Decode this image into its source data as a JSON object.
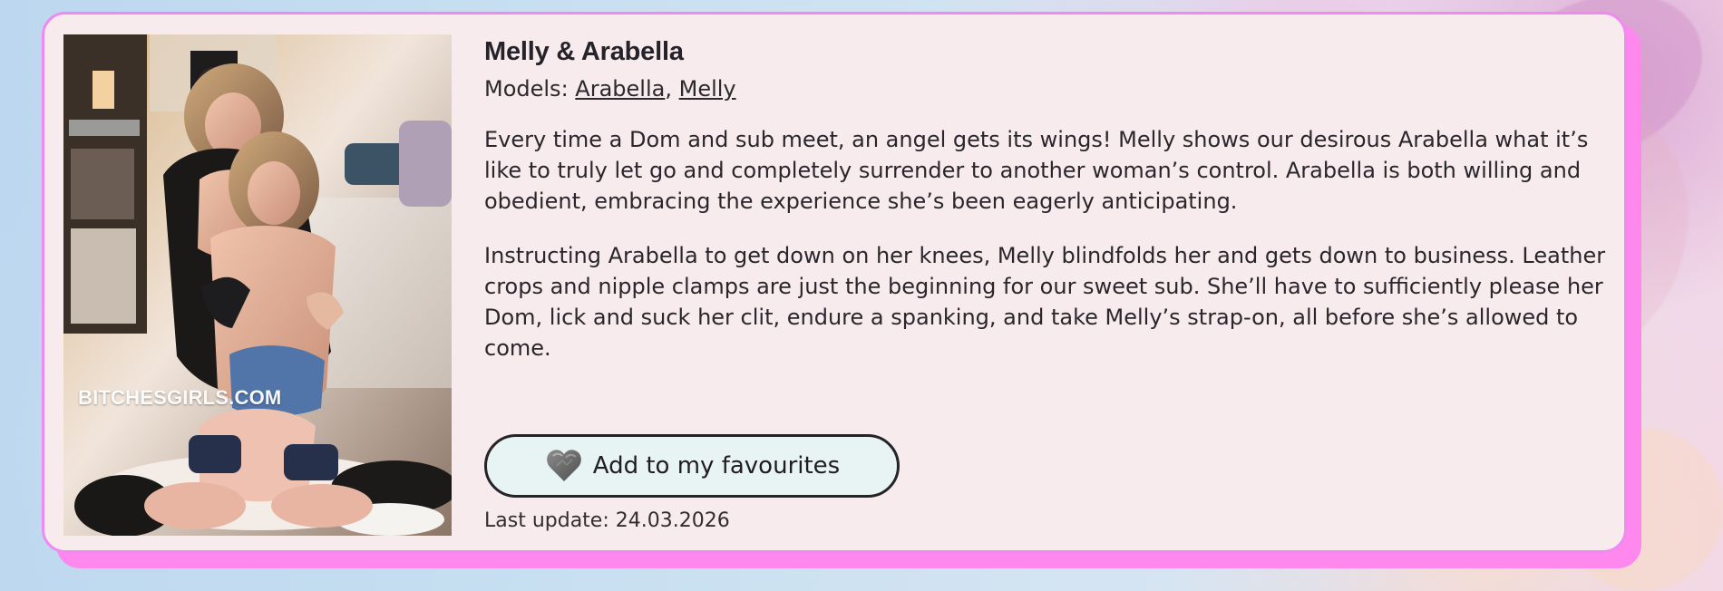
{
  "card": {
    "title": "Melly & Arabella",
    "models_label": "Models:",
    "models": [
      {
        "name": "Arabella"
      },
      {
        "name": "Melly"
      }
    ],
    "description": [
      "Every time a Dom and sub meet, an angel gets its wings! Melly shows our desirous Arabella what it’s like to truly let go and completely surrender to another woman’s control. Arabella is both willing and obedient, embracing the experience she’s been eagerly anticipating.",
      "Instructing Arabella to get down on her knees, Melly blindfolds her and gets down to business. Leather crops and nipple clamps are just the beginning for our sweet sub. She’ll have to sufficiently please her Dom, lick and suck her clit, endure a spanking, and take Melly’s strap-on, all before she’s allowed to come."
    ],
    "favourite_button_label": "Add to my favourites",
    "last_update": "Last update: 24.03.2026"
  },
  "preview": {
    "watermark": "BITCHESGIRLS.COM"
  },
  "icons": {
    "favourite": "heart-icon"
  },
  "colors": {
    "card_background": "#f7ebed",
    "card_border": "#ef8bf0",
    "card_shadow": "#ff88ef",
    "button_background": "#e8f3f4",
    "button_border": "#262326"
  }
}
